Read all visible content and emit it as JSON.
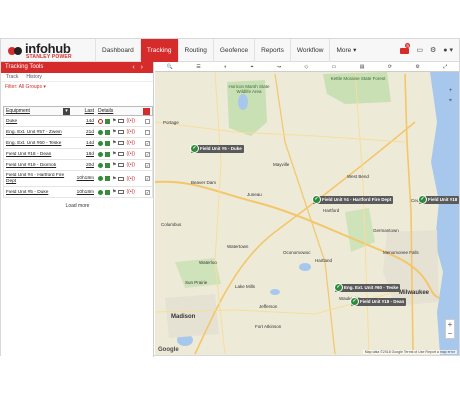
{
  "brand": {
    "name": "infohub",
    "tagline": "STANLEY POWER"
  },
  "nav": {
    "items": [
      "Dashboard",
      "Tracking",
      "Routing",
      "Geofence",
      "Reports",
      "Workflow",
      "More ▾"
    ],
    "active_index": 1,
    "notifications_count": "5",
    "user_menu": "▾"
  },
  "panel": {
    "title": "Tracking Tools",
    "tabs": [
      "Track",
      "History"
    ],
    "filter": "Filter: All Groups ▾",
    "columns": {
      "equipment": "Equipment",
      "last": "Last",
      "details": "Details"
    },
    "rows": [
      {
        "name": "Duke",
        "last": "14d",
        "status": "off",
        "checked": false
      },
      {
        "name": "Eng. Ext. Unit #57 - Zwein",
        "last": "21d",
        "status": "ok",
        "checked": false
      },
      {
        "name": "Eng. Ext. Unit #60 - Teske",
        "last": "14d",
        "status": "ok",
        "checked": true
      },
      {
        "name": "Field Unit #18 - Dean",
        "last": "18d",
        "status": "ok",
        "checked": true
      },
      {
        "name": "Field Unit #19 - Diomoti",
        "last": "20d",
        "status": "ok",
        "checked": true
      },
      {
        "name": "Field Unit #4 - Hartford Fire Dept",
        "last": "10h18m",
        "status": "ok",
        "checked": true
      },
      {
        "name": "Field Unit #5 - Duke",
        "last": "10h18m",
        "status": "ok",
        "checked": true
      }
    ],
    "load_more": "Load more"
  },
  "map": {
    "markers": [
      {
        "label": "Field Unit #5 - Duke"
      },
      {
        "label": "Field Unit #4 - Hartford Fire Dept"
      },
      {
        "label": "Field Unit #18"
      },
      {
        "label": "Eng. Ext. Unit #60 - Teske"
      },
      {
        "label": "Field Unit #18 - Dean"
      }
    ],
    "places": [
      "Beaver Dam",
      "Hartford",
      "West Bend",
      "Oconomowoc",
      "Waukesha",
      "Watertown",
      "Columbus",
      "Sun Prairie",
      "Madison",
      "Milwaukee",
      "Jefferson",
      "Fort Atkinson",
      "Lake Mills",
      "Menomonee Falls",
      "Hartland",
      "Cedarburg",
      "Germantown",
      "Mayville",
      "Juneau",
      "Waterloo",
      "Portage"
    ],
    "parks": [
      "Horicon Marsh State Wildlife Area",
      "Kettle Moraine State Forest"
    ],
    "google": "Google",
    "attribution": "Map data ©2018 Google   Terms of Use   Report a map error",
    "zoom_in": "+",
    "zoom_out": "−"
  },
  "colors": {
    "accent": "#d62b2b",
    "ok": "#2e8b3a"
  }
}
